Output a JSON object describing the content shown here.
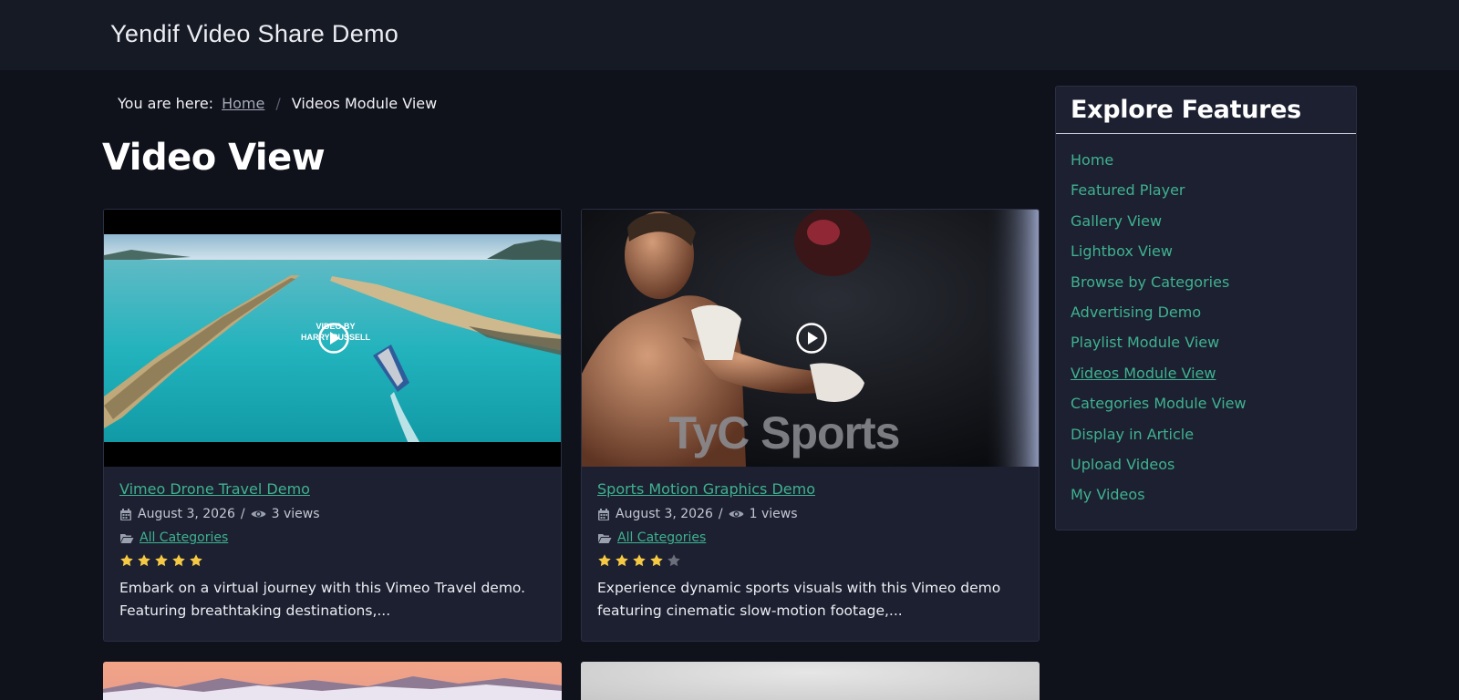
{
  "site": {
    "title": "Yendif Video Share Demo"
  },
  "breadcrumb": {
    "prefix": "You are here:",
    "home": "Home",
    "current": "Videos Module View"
  },
  "page": {
    "title": "Video View"
  },
  "videos": [
    {
      "title": "Vimeo Drone Travel Demo",
      "date": "August 3, 2026",
      "views": "3 views",
      "category": "All Categories",
      "rating": 5,
      "description": "Embark on a virtual journey with this Vimeo Travel demo. Featuring breathtaking destinations,...",
      "overlay_text": [
        "VIDEO BY",
        "HARRY RUSSELL"
      ]
    },
    {
      "title": "Sports Motion Graphics Demo",
      "date": "August 3, 2026",
      "views": "1 views",
      "category": "All Categories",
      "rating": 4,
      "description": "Experience dynamic sports visuals with this Vimeo demo featuring cinematic slow-motion footage,...",
      "watermark": "TyC Sports"
    }
  ],
  "sidebar": {
    "title": "Explore Features",
    "items": [
      {
        "label": "Home"
      },
      {
        "label": "Featured Player"
      },
      {
        "label": "Gallery View"
      },
      {
        "label": "Lightbox View"
      },
      {
        "label": "Browse by Categories"
      },
      {
        "label": "Advertising Demo"
      },
      {
        "label": "Playlist Module View"
      },
      {
        "label": "Videos Module View",
        "active": true
      },
      {
        "label": "Categories Module View"
      },
      {
        "label": "Display in Article"
      },
      {
        "label": "Upload Videos"
      },
      {
        "label": "My Videos"
      }
    ]
  },
  "colors": {
    "link": "#3fb28f",
    "background": "#0f111b",
    "card": "#1c2031",
    "star_on": "#f6c944",
    "star_off": "#6b6f7c"
  },
  "icons": {
    "date": "calendar-icon",
    "views": "eye-icon",
    "category": "folder-icon",
    "play": "play-circle-icon",
    "rating": "star-icon"
  }
}
